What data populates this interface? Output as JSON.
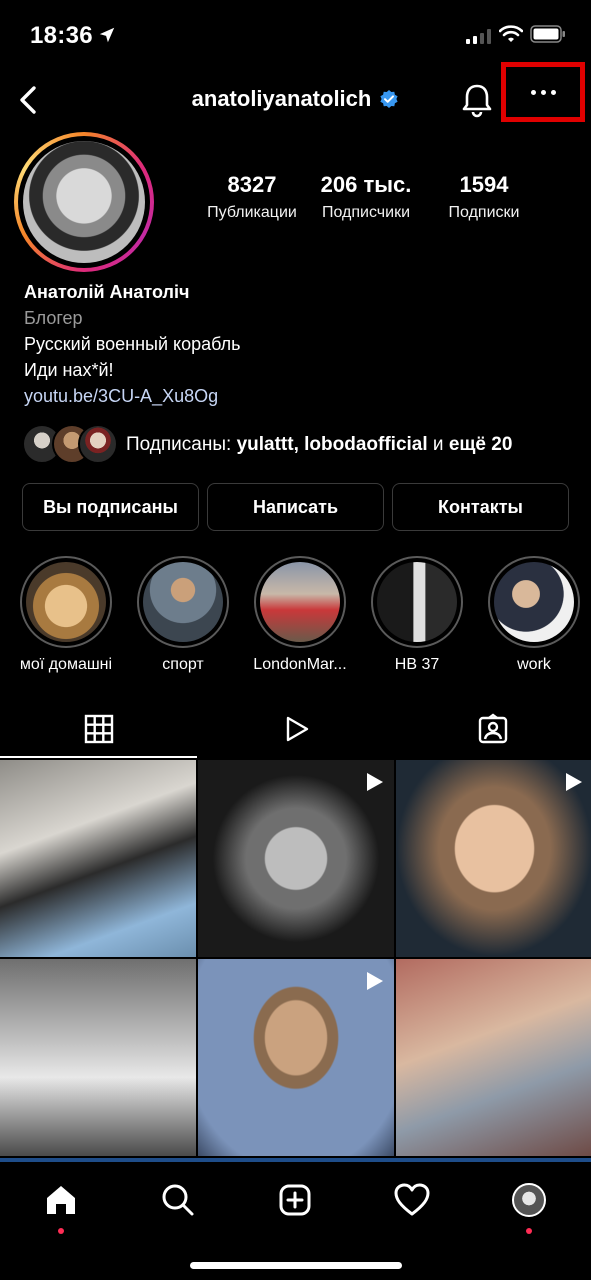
{
  "status_bar": {
    "time": "18:36"
  },
  "header": {
    "username": "anatoliyanatolich"
  },
  "stats": [
    {
      "value": "8327",
      "label": "Публикации"
    },
    {
      "value": "206 тыс.",
      "label": "Подписчики"
    },
    {
      "value": "1594",
      "label": "Подписки"
    }
  ],
  "bio": {
    "name": "Анатолій Анатоліч",
    "category": "Блогер",
    "line1": "Русский военный корабль",
    "line2": "Иди нах*й!",
    "link": "youtu.be/3CU-A_Xu8Og"
  },
  "followed_by": {
    "prefix": "Подписаны: ",
    "names": "yulattt, lobodaofficial",
    "middle": " и ",
    "suffix": "ещё 20"
  },
  "actions": {
    "following": "Вы подписаны",
    "message": "Написать",
    "contacts": "Контакты"
  },
  "highlights": [
    {
      "label": "мої домашні"
    },
    {
      "label": "спорт"
    },
    {
      "label": "LondonMar..."
    },
    {
      "label": "HB 37"
    },
    {
      "label": "work"
    }
  ],
  "colors": {
    "accent_red": "#e00000",
    "verified_blue": "#3897f0",
    "notification_dot": "#ff2d55"
  },
  "icons": {
    "tabs": [
      "grid-icon",
      "reels-icon",
      "tagged-icon"
    ],
    "nav": [
      "home-icon",
      "search-icon",
      "create-icon",
      "heart-icon",
      "profile-avatar"
    ]
  }
}
